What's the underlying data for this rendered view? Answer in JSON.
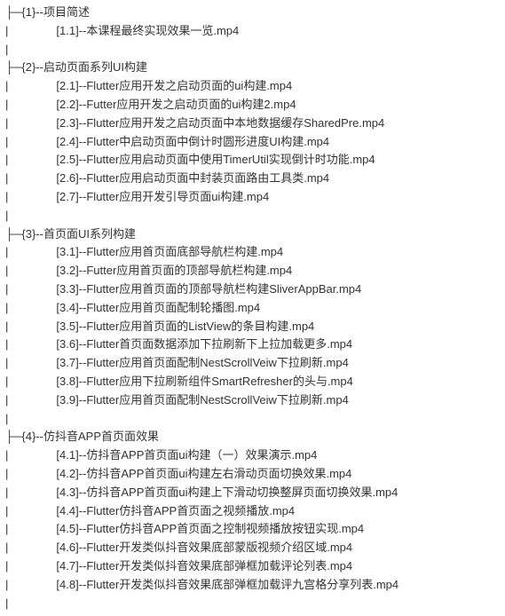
{
  "sections": [
    {
      "index": "{1}",
      "title": "项目简述",
      "items": [
        {
          "num": "[1.1]",
          "label": "本课程最终实现效果一览.mp4"
        }
      ]
    },
    {
      "index": "{2}",
      "title": "启动页面系列UI构建",
      "items": [
        {
          "num": "[2.1]",
          "label": "Flutter应用开发之启动页面的ui构建.mp4"
        },
        {
          "num": "[2.2]",
          "label": "Futter应用开发之启动页面的ui构建2.mp4"
        },
        {
          "num": "[2.3]",
          "label": "Flutter应用开发之启动页面中本地数据缓存SharedPre.mp4"
        },
        {
          "num": "[2.4]",
          "label": "Flutter中启动页面中倒计时圆形进度UI构建.mp4"
        },
        {
          "num": "[2.5]",
          "label": "Flutter应用启动页面中使用TimerUtil实现倒计时功能.mp4"
        },
        {
          "num": "[2.6]",
          "label": "Flutter应用启动页面中封装页面路由工具类.mp4"
        },
        {
          "num": "[2.7]",
          "label": "Flutter应用开发引导页面ui构建.mp4"
        }
      ]
    },
    {
      "index": "{3}",
      "title": "首页面UI系列构建",
      "items": [
        {
          "num": "[3.1]",
          "label": "Flutter应用首页面底部导航栏构建.mp4"
        },
        {
          "num": "[3.2]",
          "label": "Futter应用首页面的顶部导航栏构建.mp4"
        },
        {
          "num": "[3.3]",
          "label": "Flutter应用首页面的顶部导航栏构建SliverAppBar.mp4"
        },
        {
          "num": "[3.4]",
          "label": "Flutter应用首页面配制轮播图.mp4"
        },
        {
          "num": "[3.5]",
          "label": "Flutter应用首页面的ListView的条目构建.mp4"
        },
        {
          "num": "[3.6]",
          "label": "Flutter首页面数据添加下拉刷新下上拉加载更多.mp4"
        },
        {
          "num": "[3.7]",
          "label": "Flutter应用首页面配制NestScrollVeiw下拉刷新.mp4"
        },
        {
          "num": "[3.8]",
          "label": "Flutter应用下拉刷新组件SmartRefresher的头与.mp4"
        },
        {
          "num": "[3.9]",
          "label": "Flutter应用首页面配制NestScrollVeiw下拉刷新.mp4"
        }
      ]
    },
    {
      "index": "{4}",
      "title": "仿抖音APP首页面效果",
      "items": [
        {
          "num": "[4.1]",
          "label": "仿抖音APP首页面ui构建（一）效果演示.mp4"
        },
        {
          "num": "[4.2]",
          "label": "仿抖音APP首页面ui构建左右滑动页面切换效果.mp4"
        },
        {
          "num": "[4.3]",
          "label": "仿抖音APP首页面ui构建上下滑动切换整屏页面切换效果.mp4"
        },
        {
          "num": "[4.4]",
          "label": "Flutter仿抖音APP首页面之视频播放.mp4"
        },
        {
          "num": "[4.5]",
          "label": "Flutter仿抖音APP首页面之控制视频播放按钮实现.mp4"
        },
        {
          "num": "[4.6]",
          "label": "Flutter开发类似抖音效果底部蒙版视频介绍区域.mp4"
        },
        {
          "num": "[4.7]",
          "label": "Flutter开发类似抖音效果底部弹框加载评论列表.mp4"
        },
        {
          "num": "[4.8]",
          "label": "Flutter开发类似抖音效果底部弹框加载评九宫格分享列表.mp4"
        }
      ]
    }
  ],
  "connector_section": "├─",
  "separator": "--",
  "pipe": "|"
}
